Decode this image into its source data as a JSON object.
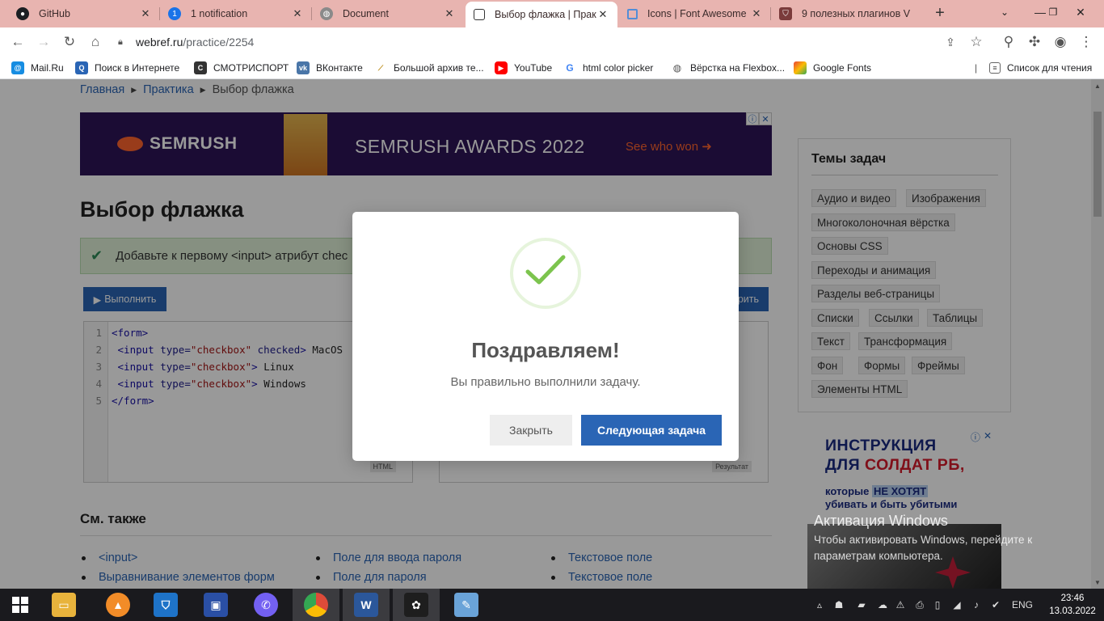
{
  "browser": {
    "tabs": [
      {
        "title": "GitHub",
        "icon": "github-icon",
        "color": "#1b1f23"
      },
      {
        "title": "1 notification",
        "icon": "notification-icon",
        "color": "#1a73e8"
      },
      {
        "title": "Document",
        "icon": "globe-icon",
        "color": "#6b6b6b"
      },
      {
        "title": "Выбор флажка | Практ",
        "icon": "webref-icon",
        "color": "#333333"
      },
      {
        "title": "Icons | Font Awesome",
        "icon": "fontawesome-icon",
        "color": "#528dd7"
      },
      {
        "title": "9 полезных плагинов V",
        "icon": "shield-icon",
        "color": "#7a3b3b"
      }
    ],
    "new_tab": "+",
    "url_host": "webref.ru",
    "url_path": "/practice/2254",
    "bookmarks": [
      {
        "label": "Mail.Ru",
        "icon": "mailru-icon",
        "color": "#168de2"
      },
      {
        "label": "Поиск в Интернете",
        "icon": "search-icon",
        "color": "#2a65b5"
      },
      {
        "label": "СМОТРИСПОРТ",
        "icon": "sport-icon",
        "color": "#333333"
      },
      {
        "label": "ВКонтакте",
        "icon": "vk-icon",
        "color": "#4a76a8"
      },
      {
        "label": "Большой архив те...",
        "icon": "broom-icon",
        "color": "#b8860b"
      },
      {
        "label": "YouTube",
        "icon": "youtube-icon",
        "color": "#ff0000"
      },
      {
        "label": "html color picker",
        "icon": "google-icon",
        "color": "#4285f4"
      },
      {
        "label": "Вёрстка на Flexbox...",
        "icon": "globe-icon",
        "color": "#555555"
      },
      {
        "label": "Google Fonts",
        "icon": "google-fonts-icon",
        "color": "#ea4335"
      }
    ],
    "reading_list": "Список для чтения"
  },
  "page": {
    "breadcrumb": [
      "Главная",
      "Практика",
      "Выбор флажка"
    ],
    "ad_banner": {
      "logo": "SEMRUSH",
      "title": "SEMRUSH AWARDS 2022",
      "cta": "See who won ➜"
    },
    "title": "Выбор флажка",
    "task_text": "Добавьте к первому <input> атрибут chec",
    "run_button": "Выполнить",
    "reset_button": "рить",
    "code_lines": [
      {
        "n": "1"
      },
      {
        "n": "2"
      },
      {
        "n": "3"
      },
      {
        "n": "4"
      },
      {
        "n": "5"
      }
    ],
    "code_tokens": {
      "form_open": "<form>",
      "input_open": "<input",
      "type_attr": "type=",
      "checkbox_val": "\"checkbox\"",
      "checked_attr": "checked",
      "close_bracket": ">",
      "text_macos": "MacOS",
      "text_linux": "Linux",
      "text_windows": "Windows",
      "form_close": "</form>"
    },
    "editor_label": "HTML",
    "result_label": "Результат",
    "see_also_title": "См. также",
    "see_also": [
      "<input>",
      "Выравнивание элементов форм",
      "Поле для ввода пароля",
      "Поле для пароля",
      "Текстовое поле",
      "Текстовое поле"
    ],
    "sidebar": {
      "title": "Темы задач",
      "tags": [
        "Аудио и видео",
        "Изображения",
        "Многоколоночная вёрстка",
        "Основы CSS",
        "Переходы и анимация",
        "Разделы веб-страницы",
        "Списки",
        "Ссылки",
        "Таблицы",
        "Текст",
        "Трансформация",
        "Фон",
        "Формы",
        "Фреймы",
        "Элементы HTML"
      ]
    },
    "ad_side": {
      "line1": "ИНСТРУКЦИЯ",
      "line2_a": "ДЛЯ ",
      "line2_b": "СОЛДАТ РБ,",
      "line3_a": "которые ",
      "line3_b": "НЕ ХОТЯТ",
      "line4": "убивать и быть убитыми"
    },
    "watermark_title": "Активация Windows",
    "watermark_text": "Чтобы активировать Windows, перейдите к параметрам компьютера."
  },
  "modal": {
    "title": "Поздравляем!",
    "text": "Вы правильно выполнили задачу.",
    "close_button": "Закрыть",
    "next_button": "Следующая задача",
    "check_color": "#7cc44e"
  },
  "taskbar": {
    "apps": [
      {
        "name": "file-explorer-icon",
        "color": "#e8b33c"
      },
      {
        "name": "avast-icon",
        "color": "#f28c28"
      },
      {
        "name": "windows-defender-icon",
        "color": "#1e73c8"
      },
      {
        "name": "save-floppy-icon",
        "color": "#2a4fa5"
      },
      {
        "name": "viber-icon",
        "color": "#7360f2"
      },
      {
        "name": "chrome-icon",
        "color": "#dd4b39"
      },
      {
        "name": "word-icon",
        "color": "#2b579a"
      },
      {
        "name": "figma-icon",
        "color": "#1e1e1e"
      },
      {
        "name": "paint-icon",
        "color": "#6aa3d8"
      }
    ],
    "lang": "ENG",
    "time": "23:46",
    "date": "13.03.2022"
  }
}
